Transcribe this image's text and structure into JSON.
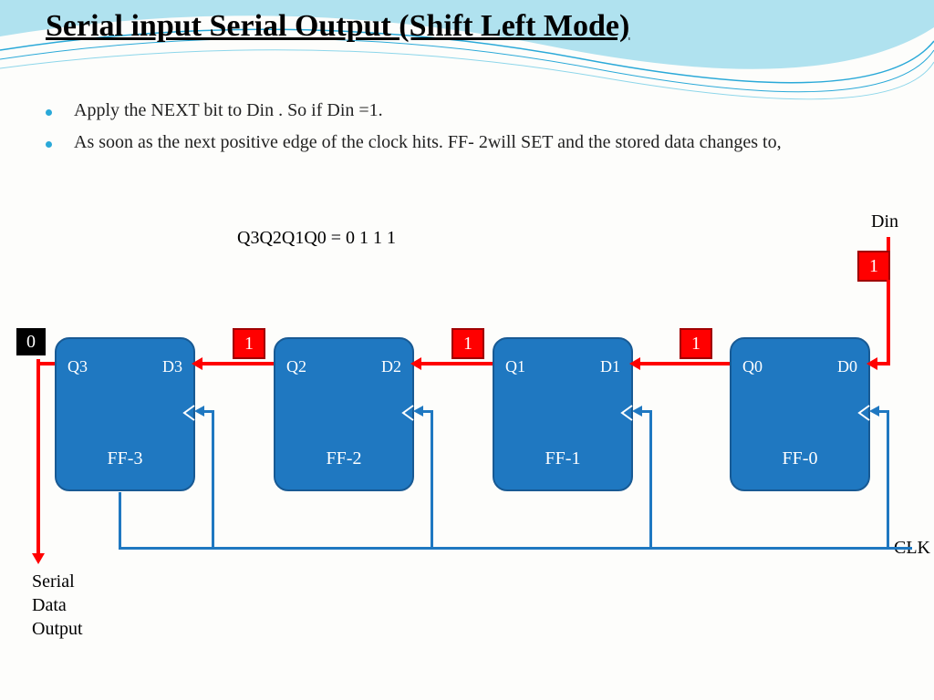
{
  "title": "Serial input Serial Output (Shift Left Mode)",
  "bullets": [
    "Apply the NEXT  bit to Din . So if Din =1.",
    "As soon as the next positive edge of the clock hits. FF- 2will SET and the stored data changes to,"
  ],
  "equation": "Q3Q2Q1Q0 = 0 1 1 1",
  "labels": {
    "din": "Din",
    "clk": "CLK",
    "output": "Serial\nData\nOutput"
  },
  "din_value": "1",
  "output_value": "0",
  "inter_values": [
    "1",
    "1",
    "1"
  ],
  "flipflops": [
    {
      "q": "Q3",
      "d": "D3",
      "name": "FF-3"
    },
    {
      "q": "Q2",
      "d": "D2",
      "name": "FF-2"
    },
    {
      "q": "Q1",
      "d": "D1",
      "name": "FF-1"
    },
    {
      "q": "Q0",
      "d": "D0",
      "name": "FF-0"
    }
  ]
}
